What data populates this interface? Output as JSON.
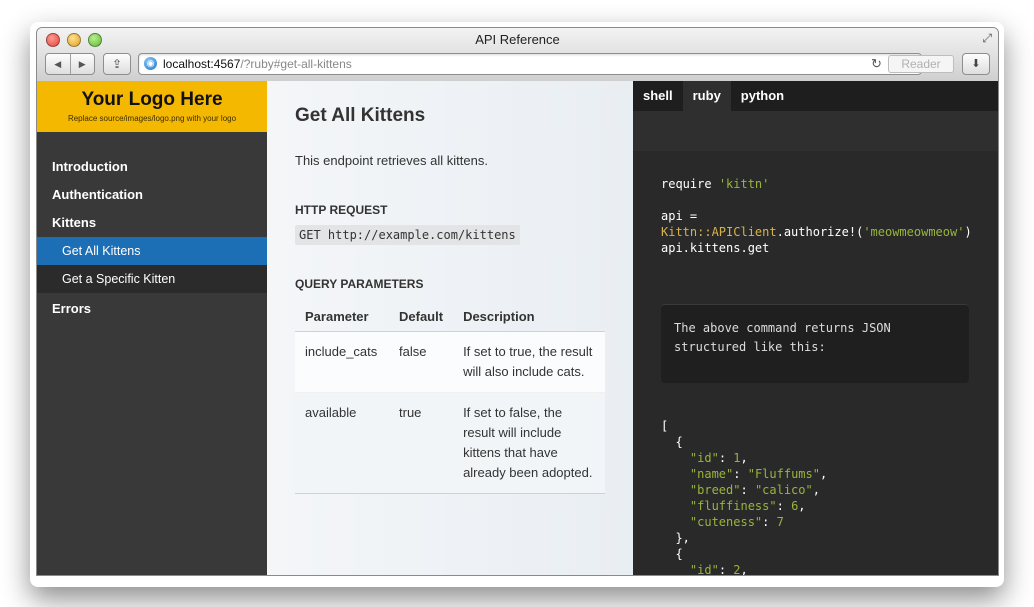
{
  "window": {
    "title": "API Reference",
    "url_host": "localhost:4567",
    "url_rest": "/?ruby#get-all-kittens",
    "reader_label": "Reader"
  },
  "sidebar": {
    "logo_title": "Your Logo Here",
    "logo_subtitle": "Replace source/images/logo.png with your logo",
    "items": [
      {
        "label": "Introduction",
        "level": 1
      },
      {
        "label": "Authentication",
        "level": 1
      },
      {
        "label": "Kittens",
        "level": 1
      },
      {
        "label": "Get All Kittens",
        "level": 2,
        "active": true
      },
      {
        "label": "Get a Specific Kitten",
        "level": 2
      },
      {
        "label": "Errors",
        "level": 1
      }
    ]
  },
  "main": {
    "title": "Get All Kittens",
    "intro": "This endpoint retrieves all kittens.",
    "http_heading": "HTTP REQUEST",
    "http_request": "GET http://example.com/kittens",
    "params_heading": "QUERY PARAMETERS",
    "table": {
      "headers": [
        "Parameter",
        "Default",
        "Description"
      ],
      "rows": [
        [
          "include_cats",
          "false",
          "If set to true, the result will also include cats."
        ],
        [
          "available",
          "true",
          "If set to false, the result will include kittens that have already been adopted."
        ]
      ]
    }
  },
  "code": {
    "tabs": [
      "shell",
      "ruby",
      "python"
    ],
    "active_tab": "ruby",
    "require_kw": "require",
    "require_str": "'kittn'",
    "api_assign": "api =",
    "client_ns": "Kittn",
    "client_sep": "::",
    "client_cls": "APIClient",
    "client_call": ".authorize!(",
    "client_key": "'meowmeowmeow'",
    "client_close": ")",
    "api_get": "api.kittens.get",
    "note": "The above command returns JSON structured like this:",
    "json_lines": [
      "[",
      "  {",
      "    \"id\": 1,",
      "    \"name\": \"Fluffums\",",
      "    \"breed\": \"calico\",",
      "    \"fluffiness\": 6,",
      "    \"cuteness\": 7",
      "  },",
      "  {",
      "    \"id\": 2,"
    ]
  },
  "colors": {
    "logo_bg": "#f5b800",
    "sidebar_bg": "#393939",
    "active_item": "#1c6eb5",
    "code_bg": "#292929",
    "string_green": "#97b53a",
    "class_yellow": "#d8b34a"
  }
}
